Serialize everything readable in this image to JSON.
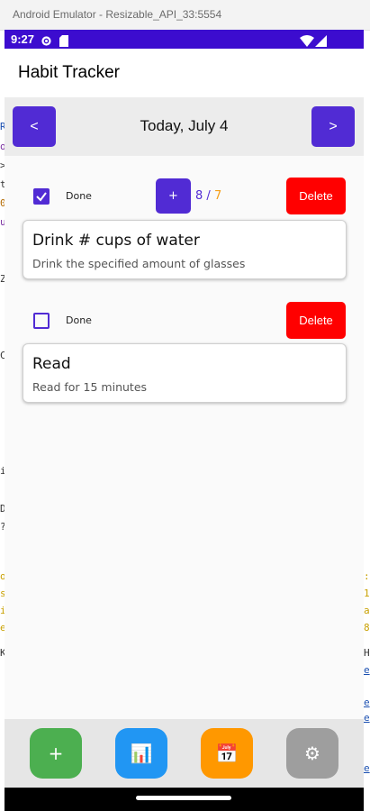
{
  "window": {
    "title": "Android Emulator - Resizable_API_33:5554"
  },
  "status_bar": {
    "time": "9:27",
    "background": "#3c0ccf"
  },
  "app_bar": {
    "title": "Habit Tracker"
  },
  "date_nav": {
    "prev_label": "<",
    "date": "Today, July 4",
    "next_label": ">"
  },
  "habits": [
    {
      "done_label": "Done",
      "checked": true,
      "increment_label": "+",
      "current": "8",
      "separator": "/",
      "goal": "7",
      "delete_label": "Delete",
      "title": "Drink # cups of water",
      "description": "Drink the specified amount of glasses"
    },
    {
      "done_label": "Done",
      "checked": false,
      "delete_label": "Delete",
      "title": "Read",
      "description": "Read for 15 minutes"
    }
  ],
  "bottom_bar": {
    "buttons": [
      {
        "icon": "plus-icon",
        "label": "+",
        "color": "#4caf50"
      },
      {
        "icon": "bar-chart-icon",
        "label": "📊",
        "color": "#2196f3"
      },
      {
        "icon": "calendar-icon",
        "label": "📅",
        "color": "#ff9800"
      },
      {
        "icon": "gear-icon",
        "label": "⚙",
        "color": "#9e9e9e"
      }
    ]
  },
  "colors": {
    "accent": "#512bd4",
    "delete": "#ff0000",
    "goal": "#f6a01a"
  }
}
